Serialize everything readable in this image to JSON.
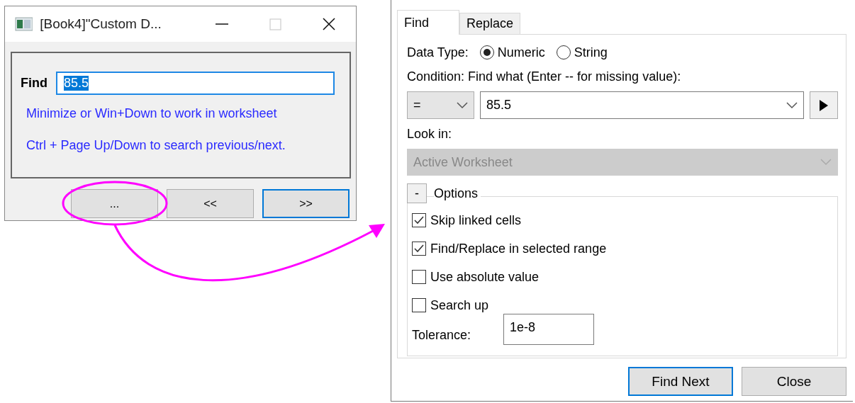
{
  "custom_dialog": {
    "title": "[Book4]\"Custom D...",
    "find_label": "Find",
    "find_value": "85.5",
    "hints": [
      "Minimize or Win+Down to work in worksheet",
      "Ctrl + Page Up/Down to search previous/next."
    ],
    "buttons": [
      {
        "label": "...",
        "focused": false
      },
      {
        "label": "<<",
        "focused": false
      },
      {
        "label": ">>",
        "focused": true
      }
    ]
  },
  "find_replace": {
    "tabs": [
      {
        "label": "Find",
        "selected": true
      },
      {
        "label": "Replace",
        "selected": false
      }
    ],
    "data_type_label": "Data Type:",
    "data_types": [
      {
        "label": "Numeric",
        "selected": true
      },
      {
        "label": "String",
        "selected": false
      }
    ],
    "condition_label": "Condition:",
    "find_what_label": "Find what (Enter -- for missing value):",
    "condition_value": "=",
    "find_what_value": "85.5",
    "look_in_label": "Look in:",
    "look_in": {
      "value": "Active Worksheet",
      "disabled": true
    },
    "options": {
      "toggle": "-",
      "label": "Options",
      "expanded": true
    },
    "checkboxes": [
      {
        "label": "Skip linked cells",
        "checked": true
      },
      {
        "label": "Find/Replace in selected range",
        "checked": true
      },
      {
        "label": "Use absolute value",
        "checked": false
      },
      {
        "label": "Search up",
        "checked": false
      }
    ],
    "tolerance_label": "Tolerance:",
    "tolerance_value": "1e-8",
    "buttons": [
      {
        "label": "Find Next",
        "default": true
      },
      {
        "label": "Close",
        "default": false
      }
    ]
  }
}
